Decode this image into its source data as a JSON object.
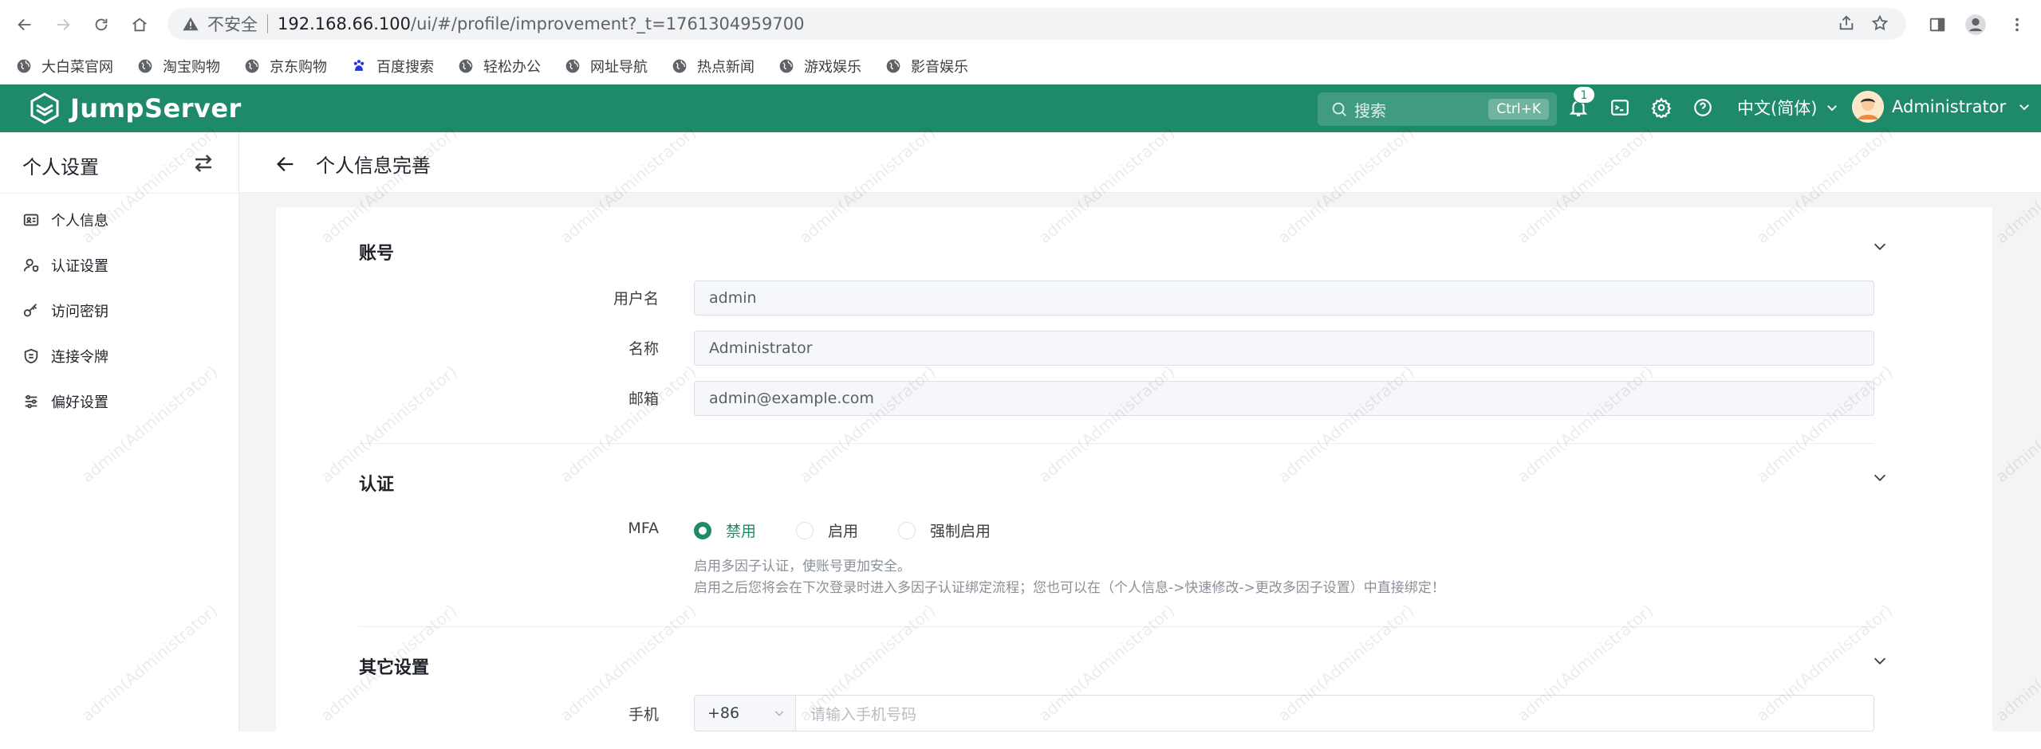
{
  "browser": {
    "insecure_label": "不安全",
    "url_host": "192.168.66.100",
    "url_path": "/ui/#/profile/improvement?_t=1761304959700",
    "bookmarks": [
      "大白菜官网",
      "淘宝购物",
      "京东购物",
      "百度搜索",
      "轻松办公",
      "网址导航",
      "热点新闻",
      "游戏娱乐",
      "影音娱乐"
    ]
  },
  "header": {
    "logo_text": "JumpServer",
    "search_placeholder": "搜索",
    "search_shortcut": "Ctrl+K",
    "notification_count": "1",
    "language": "中文(简体)",
    "username": "Administrator",
    "brand_color": "#1f8a6a"
  },
  "sidebar": {
    "title": "个人设置",
    "items": [
      {
        "label": "个人信息",
        "icon": "id-card-icon"
      },
      {
        "label": "认证设置",
        "icon": "user-shield-icon"
      },
      {
        "label": "访问密钥",
        "icon": "key-icon"
      },
      {
        "label": "连接令牌",
        "icon": "token-icon"
      },
      {
        "label": "偏好设置",
        "icon": "sliders-icon"
      }
    ]
  },
  "page": {
    "title": "个人信息完善",
    "sections": {
      "account": {
        "title": "账号",
        "fields": [
          {
            "label": "用户名",
            "value": "admin"
          },
          {
            "label": "名称",
            "value": "Administrator"
          },
          {
            "label": "邮箱",
            "value": "admin@example.com"
          }
        ]
      },
      "auth": {
        "title": "认证",
        "mfa_label": "MFA",
        "options": [
          "禁用",
          "启用",
          "强制启用"
        ],
        "selected": "禁用",
        "help_line1": "启用多因子认证，使账号更加安全。",
        "help_line2": "启用之后您将会在下次登录时进入多因子认证绑定流程；您也可以在（个人信息->快速修改->更改多因子设置）中直接绑定！"
      },
      "other": {
        "title": "其它设置",
        "phone_label": "手机",
        "phone_code": "+86",
        "phone_placeholder": "请输入手机号码"
      }
    }
  },
  "watermark_text": "admin(Administrator)"
}
